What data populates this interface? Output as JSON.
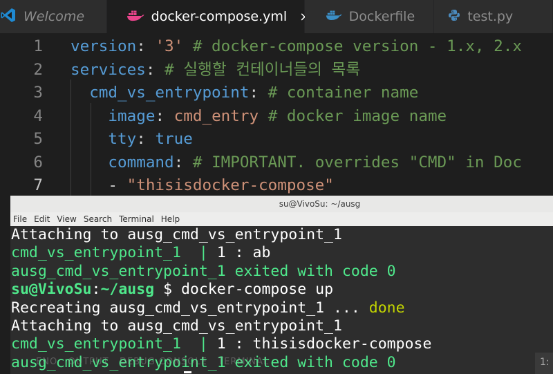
{
  "tabs": [
    {
      "label": "Welcome",
      "icon": "vscode-icon",
      "active": false
    },
    {
      "label": "docker-compose.yml",
      "icon": "docker-icon",
      "active": true,
      "close": "×"
    },
    {
      "label": "Dockerfile",
      "icon": "docker-icon",
      "active": false
    },
    {
      "label": "test.py",
      "icon": "python-icon",
      "active": false
    }
  ],
  "editor": {
    "current_line": 7,
    "lines": [
      {
        "n": "1",
        "parts": [
          [
            "key",
            "version"
          ],
          [
            "punc",
            ": "
          ],
          [
            "str",
            "'3'"
          ],
          [
            "cmt",
            " # docker-compose version - 1.x, 2.x"
          ]
        ]
      },
      {
        "n": "2",
        "parts": [
          [
            "key",
            "services"
          ],
          [
            "punc",
            ": "
          ],
          [
            "cmt",
            "# 실행할 컨테이너들의 목록"
          ]
        ]
      },
      {
        "n": "3",
        "parts": [
          [
            "punc",
            "  "
          ],
          [
            "key",
            "cmd_vs_entrypoint"
          ],
          [
            "punc",
            ": "
          ],
          [
            "cmt",
            "# container name"
          ]
        ]
      },
      {
        "n": "4",
        "parts": [
          [
            "punc",
            "    "
          ],
          [
            "key",
            "image"
          ],
          [
            "punc",
            ": "
          ],
          [
            "str",
            "cmd_entry"
          ],
          [
            "cmt",
            " # docker image name"
          ]
        ]
      },
      {
        "n": "5",
        "parts": [
          [
            "punc",
            "    "
          ],
          [
            "key",
            "tty"
          ],
          [
            "punc",
            ": "
          ],
          [
            "bool",
            "true"
          ]
        ]
      },
      {
        "n": "6",
        "parts": [
          [
            "punc",
            "    "
          ],
          [
            "key",
            "command"
          ],
          [
            "punc",
            ": "
          ],
          [
            "cmt",
            "# IMPORTANT. overrides \"CMD\" in Doc"
          ]
        ]
      },
      {
        "n": "7",
        "parts": [
          [
            "punc",
            "    - "
          ],
          [
            "str",
            "\"thisisdocker-compose\""
          ]
        ]
      }
    ]
  },
  "terminal": {
    "title": "su@VivoSu: ~/ausg",
    "menu": [
      "File",
      "Edit",
      "View",
      "Search",
      "Terminal",
      "Help"
    ],
    "lines": [
      [
        [
          "plain",
          "Attaching to ausg_cmd_vs_entrypoint_1"
        ]
      ],
      [
        [
          "green",
          "cmd_vs_entrypoint_1  |"
        ],
        [
          "plain",
          " 1 : ab"
        ]
      ],
      [
        [
          "green",
          "ausg_cmd_vs_entrypoint_1 exited with code 0"
        ]
      ],
      [
        [
          "user",
          "su@VivoSu"
        ],
        [
          "plain",
          ":"
        ],
        [
          "user",
          "~/ausg"
        ],
        [
          "plain",
          " $ docker-compose up"
        ]
      ],
      [
        [
          "plain",
          "Recreating ausg_cmd_vs_entrypoint_1 ... "
        ],
        [
          "done",
          "done"
        ]
      ],
      [
        [
          "plain",
          "Attaching to ausg_cmd_vs_entrypoint_1"
        ]
      ],
      [
        [
          "green",
          "cmd_vs_entrypoint_1  |"
        ],
        [
          "plain",
          " 1 : thisisdocker-compose"
        ]
      ],
      [
        [
          "green",
          "ausg_cmd_vs_entrypoint_1 exited with code 0"
        ]
      ]
    ]
  },
  "panel_ghost": "ENO   OUTPUT   DEBUG CONSOLE   TERMINAL",
  "corner_label": "1:",
  "colors": {
    "editor_bg": "#1e1e1e",
    "keyword": "#569cd6",
    "string": "#ce9178",
    "comment": "#6a9955",
    "terminal_green": "#4fe88b",
    "terminal_done": "#c4d600"
  }
}
